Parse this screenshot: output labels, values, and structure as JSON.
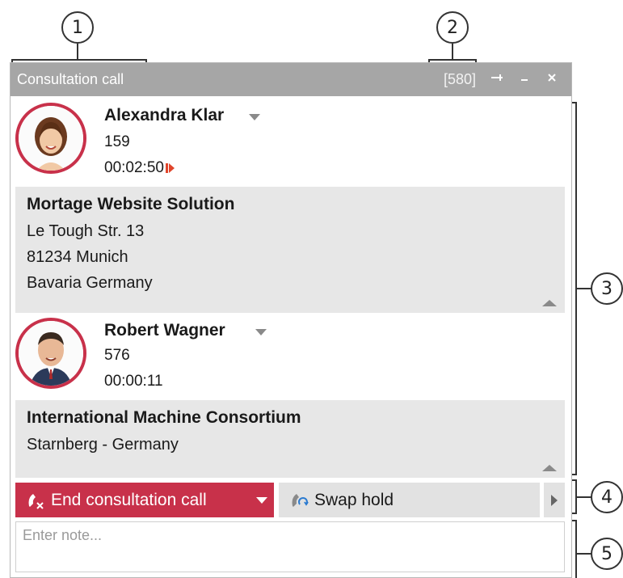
{
  "callouts": [
    "1",
    "2",
    "3",
    "4",
    "5"
  ],
  "window": {
    "title": "Consultation call",
    "counter": "[580]",
    "pin_icon": "pin-icon",
    "minimize_icon": "minimize-icon",
    "close_icon": "close-icon"
  },
  "contacts": [
    {
      "name": "Alexandra Klar",
      "number": "159",
      "duration": "00:02:50",
      "company": "Mortage Website Solution",
      "address_lines": [
        "Le Tough Str. 13",
        "81234 Munich",
        "Bavaria Germany"
      ]
    },
    {
      "name": "Robert Wagner",
      "number": "576",
      "duration": "00:00:11",
      "company": "International Machine Consortium",
      "address_lines": [
        "Starnberg - Germany"
      ]
    }
  ],
  "actions": {
    "end_call_label": "End consultation call",
    "swap_hold_label": "Swap hold"
  },
  "note": {
    "placeholder": "Enter note..."
  },
  "colors": {
    "accent": "#c8314a",
    "titlebar": "#a6a6a6",
    "panel": "#e7e7e7"
  }
}
